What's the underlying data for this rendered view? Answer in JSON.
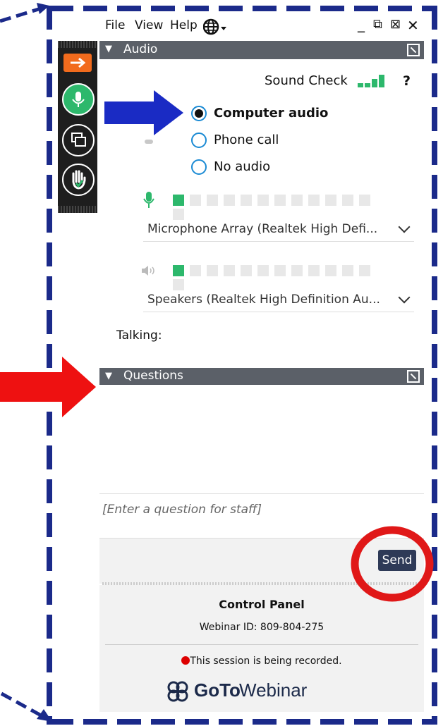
{
  "menubar": {
    "items": [
      "File",
      "View",
      "Help"
    ],
    "globe_icon": "globe-icon",
    "window_controls": [
      "_",
      "⧉",
      "⊠",
      "✕"
    ]
  },
  "audio": {
    "title": "Audio",
    "sound_check": "Sound Check",
    "help": "?",
    "options": [
      "Computer audio",
      "Phone call",
      "No audio"
    ],
    "selected": "Computer audio",
    "mic_level": 0.08,
    "speaker_level": 0.08,
    "microphone": "Microphone Array (Realtek High Defi...",
    "speakers": "Speakers (Realtek High Definition Au...",
    "talking_label": "Talking:"
  },
  "questions": {
    "title": "Questions",
    "placeholder": "[Enter a question for staff]",
    "send_label": "Send"
  },
  "footer": {
    "title": "Control Panel",
    "webinar_id": "Webinar ID: 809-804-275",
    "recording": "This session is being recorded.",
    "brand_goto": "GoTo",
    "brand_webinar": "Webinar"
  },
  "colors": {
    "dashed_border": "#1b2a8a",
    "blue_arrow": "#1a2bc4",
    "red_arrow": "#ee1111",
    "red_circle": "#e01818",
    "section_header": "#5b6068",
    "meter_on": "#2db86c",
    "sound_check": "#1a56c4"
  }
}
